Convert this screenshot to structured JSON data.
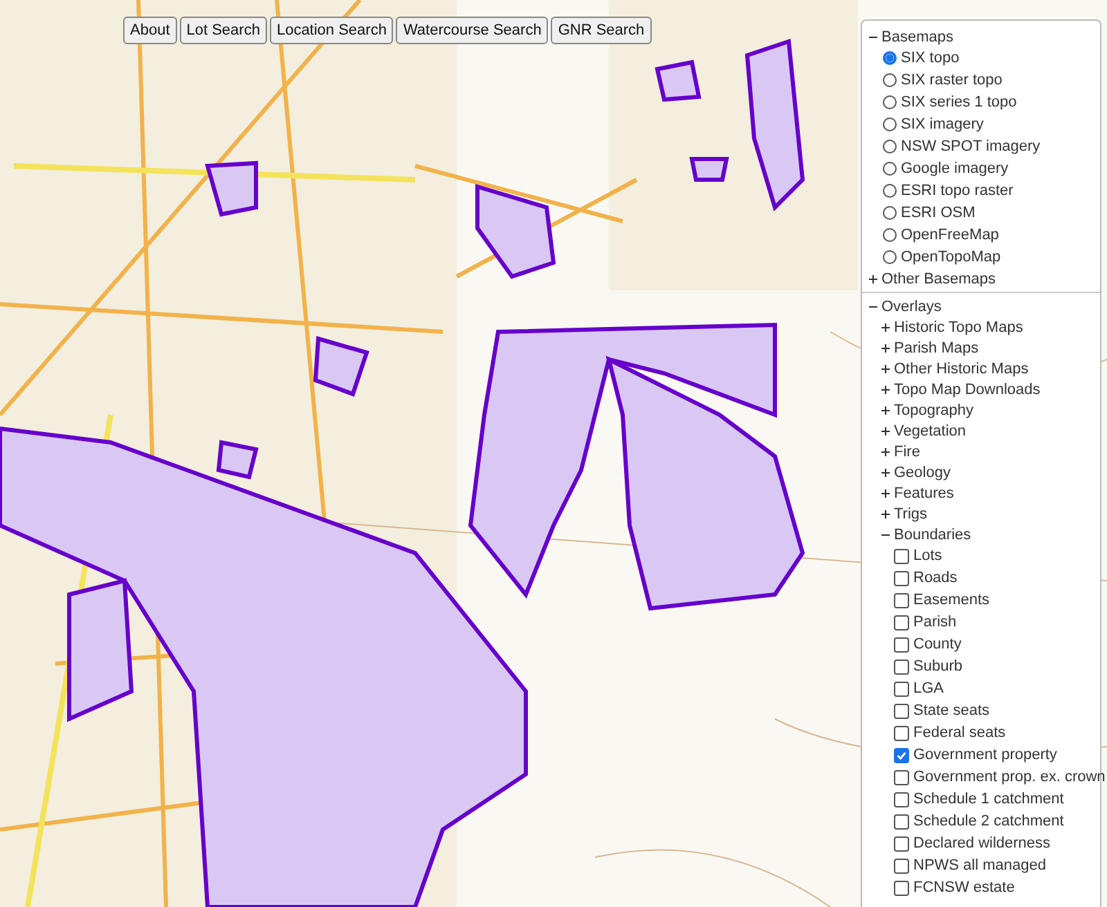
{
  "toolbar": {
    "buttons": [
      "About",
      "Lot Search",
      "Location Search",
      "Watercourse Search",
      "GNR Search"
    ]
  },
  "layer_panel": {
    "basemaps": {
      "label": "Basemaps",
      "expanded": true,
      "options": [
        {
          "label": "SIX topo",
          "selected": true
        },
        {
          "label": "SIX raster topo",
          "selected": false
        },
        {
          "label": "SIX series 1 topo",
          "selected": false
        },
        {
          "label": "SIX imagery",
          "selected": false
        },
        {
          "label": "NSW SPOT imagery",
          "selected": false
        },
        {
          "label": "Google imagery",
          "selected": false
        },
        {
          "label": "ESRI topo raster",
          "selected": false
        },
        {
          "label": "ESRI OSM",
          "selected": false
        },
        {
          "label": "OpenFreeMap",
          "selected": false
        },
        {
          "label": "OpenTopoMap",
          "selected": false
        }
      ],
      "more": {
        "label": "Other Basemaps",
        "expanded": false
      }
    },
    "overlays": {
      "label": "Overlays",
      "expanded": true,
      "groups": [
        {
          "label": "Historic Topo Maps",
          "expanded": false
        },
        {
          "label": "Parish Maps",
          "expanded": false
        },
        {
          "label": "Other Historic Maps",
          "expanded": false
        },
        {
          "label": "Topo Map Downloads",
          "expanded": false
        },
        {
          "label": "Topography",
          "expanded": false
        },
        {
          "label": "Vegetation",
          "expanded": false
        },
        {
          "label": "Fire",
          "expanded": false
        },
        {
          "label": "Geology",
          "expanded": false
        },
        {
          "label": "Features",
          "expanded": false
        },
        {
          "label": "Trigs",
          "expanded": false
        },
        {
          "label": "Boundaries",
          "expanded": true,
          "children": [
            {
              "label": "Lots",
              "checked": false
            },
            {
              "label": "Roads",
              "checked": false
            },
            {
              "label": "Easements",
              "checked": false
            },
            {
              "label": "Parish",
              "checked": false
            },
            {
              "label": "County",
              "checked": false
            },
            {
              "label": "Suburb",
              "checked": false
            },
            {
              "label": "LGA",
              "checked": false
            },
            {
              "label": "State seats",
              "checked": false
            },
            {
              "label": "Federal seats",
              "checked": false
            },
            {
              "label": "Government property",
              "checked": true
            },
            {
              "label": "Government prop. ex. crown",
              "checked": false
            },
            {
              "label": "Schedule 1 catchment",
              "checked": false
            },
            {
              "label": "Schedule 2 catchment",
              "checked": false
            },
            {
              "label": "Declared wilderness",
              "checked": false
            },
            {
              "label": "NPWS all managed",
              "checked": false
            },
            {
              "label": "FCNSW estate",
              "checked": false
            }
          ]
        }
      ]
    }
  }
}
